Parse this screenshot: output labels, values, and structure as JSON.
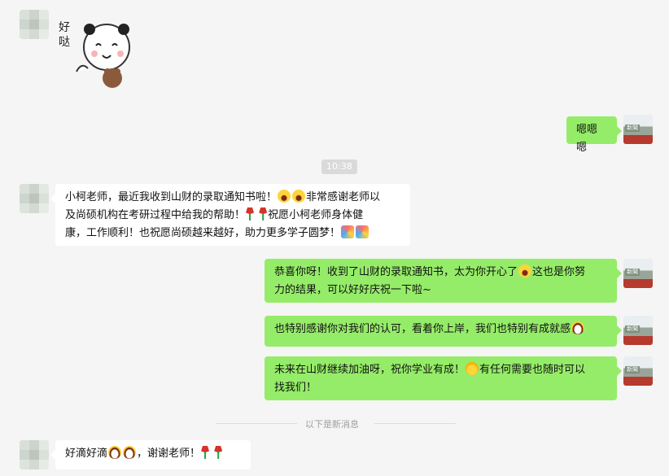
{
  "sticker": {
    "text": "好\n哒"
  },
  "messages": {
    "m1": "嗯嗯嗯",
    "time": "10:38",
    "m2_line1_a": "小柯老师，最近我收到山财的录取通知书啦！",
    "m2_line1_b": "非常感谢老师以",
    "m2_line2_a": "及尚硕机构在考研过程中给我的帮助！",
    "m2_line2_b": "祝愿小柯老师身体健",
    "m2_line3": "康，工作顺利！也祝愿尚硕越来越好，助力更多学子圆梦！",
    "m3_line1_a": "恭喜你呀！收到了山财的录取通知书，太为你开心了",
    "m3_line1_b": "这也是你努",
    "m3_line2": "力的结果，可以好好庆祝一下啦~",
    "m4": "也特别感谢你对我们的认可，看着你上岸，我们也特别有成就感",
    "m5_line1_a": "未来在山财继续加油呀，祝你学业有成！",
    "m5_line1_b": "有任何需要也随时可以",
    "m5_line2": "找我们！",
    "divider": "以下是新消息",
    "m6_a": "好滴好滴",
    "m6_b": "，谢谢老师！"
  },
  "avatar_tag": "新聞"
}
